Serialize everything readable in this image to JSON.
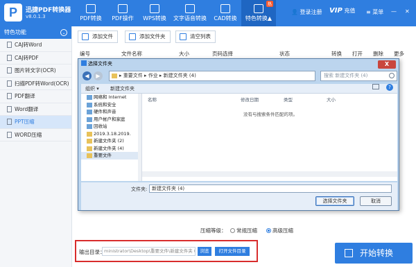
{
  "app": {
    "name": "迅捷PDF转换器",
    "version": "v8.0.1.3",
    "logo_letter": "P"
  },
  "nav": {
    "tabs": [
      {
        "label": "PDF转换",
        "icon": "pdf-convert-icon"
      },
      {
        "label": "PDF操作",
        "icon": "pdf-operate-icon"
      },
      {
        "label": "WPS转换",
        "icon": "wps-icon"
      },
      {
        "label": "文字语音转换",
        "icon": "speech-icon"
      },
      {
        "label": "CAD转换",
        "icon": "cad-icon"
      },
      {
        "label": "特色转换▲",
        "icon": "feature-icon",
        "badge": "热"
      }
    ],
    "login": "登录注册",
    "vip": "VIP",
    "recharge": "充值",
    "menu": "菜单"
  },
  "sidebar": {
    "header": "特色功能",
    "items": [
      "CAJ转Word",
      "CAJ转PDF",
      "图片转文字(OCR)",
      "扫描PDF转Word(OCR)",
      "PDF翻译",
      "Word翻译",
      "PPT压缩",
      "WORD压缩"
    ],
    "active_index": 6
  },
  "toolbar": {
    "add_file": "添加文件",
    "add_folder": "添加文件夹",
    "clear_list": "清空列表"
  },
  "table": {
    "columns": [
      "编号",
      "文件名称",
      "大小",
      "页码选择",
      "状态",
      "转换",
      "打开",
      "删除",
      "更多"
    ]
  },
  "dialog": {
    "title": "选择文件夹",
    "close": "X",
    "path": "▸ 重要文件 ▸ 作业 ▸ 新建文件夹 (4)",
    "search_placeholder": "搜索 新建文件夹 (4)",
    "organize": "组织 ▾",
    "new_folder": "新建文件夹",
    "help": "?",
    "tree": [
      {
        "label": "网络和 Internet",
        "sys": true
      },
      {
        "label": "系统和安全",
        "sys": true
      },
      {
        "label": "硬件和声音",
        "sys": true
      },
      {
        "label": "用户帐户和家庭",
        "sys": true
      },
      {
        "label": "回收站",
        "sys": true
      },
      {
        "label": "2019.3.18.2019.",
        "sys": false
      },
      {
        "label": "新建文件夹 (2)",
        "sys": false
      },
      {
        "label": "新建文件夹 (4)",
        "sys": false
      },
      {
        "label": "重要文件",
        "sys": false
      }
    ],
    "list_columns": {
      "name": "名称",
      "modified": "修改日期",
      "type": "类型",
      "size": "大小"
    },
    "empty_text": "没有与搜索条件匹配的项。",
    "folder_label": "文件夹:",
    "folder_value": "新建文件夹 (4)",
    "select_button": "选择文件夹",
    "cancel_button": "取消"
  },
  "compression": {
    "label": "压缩等级：",
    "normal": "常规压缩",
    "high": "高级压缩"
  },
  "output": {
    "label": "输出目录：",
    "path": "ministrator\\Desktop\\重要文件\\新建文件夹 (2)",
    "browse": "浏览",
    "open_dir": "打开文件目录"
  },
  "start_button": "开始转换",
  "colors": {
    "primary": "#2f7ee0",
    "highlight_frame": "#d82c2c",
    "close": "#c9463d"
  }
}
